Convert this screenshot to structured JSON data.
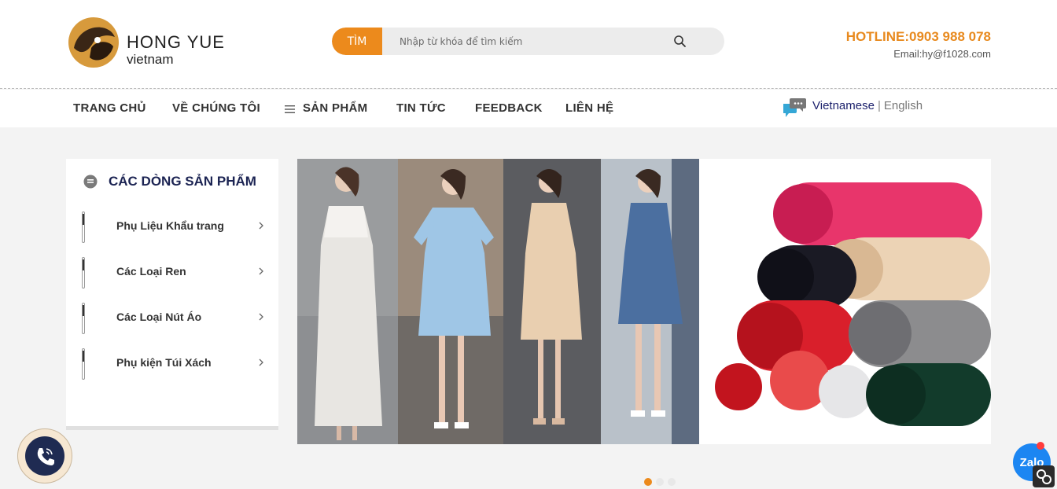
{
  "header": {
    "logo_title": "HONG YUE",
    "logo_sub": "vietnam",
    "search_button": "TÌM",
    "search_placeholder": "Nhập từ khóa để tìm kiếm",
    "hotline": "HOTLINE:0903 988 078",
    "email": "Email:hy@f1028.com"
  },
  "nav": {
    "items": [
      "TRANG CHỦ",
      "VỀ CHÚNG TÔI",
      "SẢN PHẨM",
      "TIN TỨC",
      "FEEDBACK",
      "LIÊN HỆ"
    ],
    "lang_active": "Vietnamese",
    "lang_sep": "|",
    "lang_other": "English"
  },
  "sidebar": {
    "title": "CÁC DÒNG SẢN PHẨM",
    "items": [
      {
        "label": "Phụ Liệu Khẩu trang"
      },
      {
        "label": "Các Loại Ren"
      },
      {
        "label": "Các Loại Nút Áo"
      },
      {
        "label": "Phụ kiện Túi Xách"
      }
    ]
  },
  "floating": {
    "zalo_label": "Zalo"
  },
  "colors": {
    "accent": "#ec8a1c",
    "navy": "#1c2453",
    "zalo": "#1c86f2"
  }
}
